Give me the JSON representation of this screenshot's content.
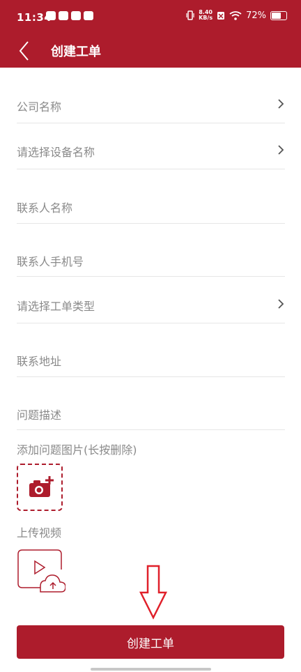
{
  "status_bar": {
    "time": "11:34",
    "net_speed_value": "8.40",
    "net_speed_unit": "KB/s",
    "battery": "72%"
  },
  "header": {
    "title": "创建工单"
  },
  "form": {
    "company": "公司名称",
    "device": "请选择设备名称",
    "contact_name": "联系人名称",
    "contact_phone": "联系人手机号",
    "order_type": "请选择工单类型",
    "address": "联系地址",
    "problem": "问题描述"
  },
  "upload": {
    "image_label": "添加问题图片(长按删除)",
    "video_label": "上传视频"
  },
  "submit_label": "创建工单",
  "colors": {
    "primary": "#ad1c2c"
  }
}
